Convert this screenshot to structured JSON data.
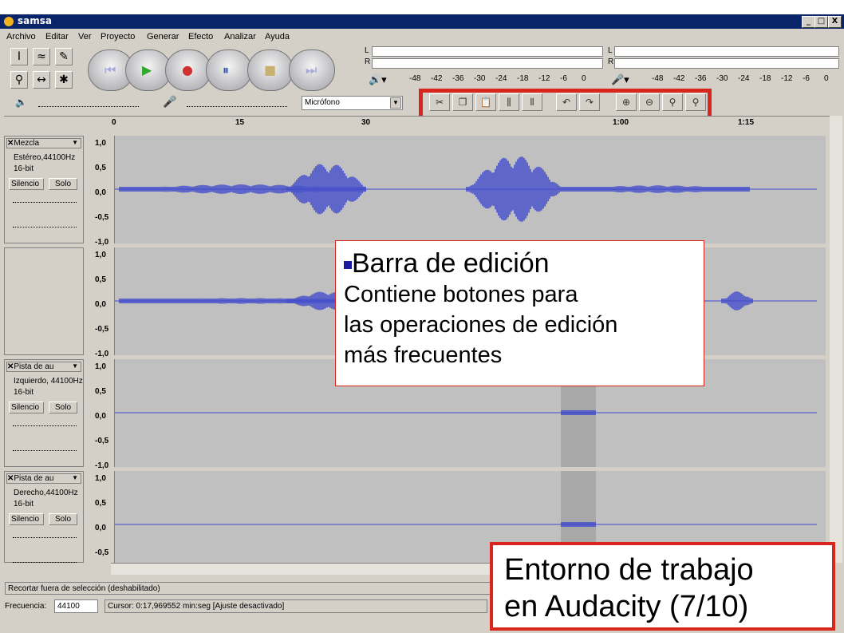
{
  "window": {
    "title": "samsa",
    "buttons": [
      "_",
      "□",
      "X"
    ]
  },
  "menu": [
    "Archivo",
    "Editar",
    "Ver",
    "Proyecto",
    "Generar",
    "Efecto",
    "Analizar",
    "Ayuda"
  ],
  "meters": {
    "left_label": "L",
    "right_label": "R",
    "scale": [
      "-48",
      "-42",
      "-36",
      "-30",
      "-24",
      "-18",
      "-12",
      "-6",
      "0"
    ]
  },
  "mixer": {
    "input_select": "Micrófono"
  },
  "ruler": {
    "ticks": [
      "0",
      "15",
      "30",
      "1:00",
      "1:15"
    ]
  },
  "tracks": [
    {
      "name": "Mezcla",
      "info1": "Estéreo,44100Hz",
      "info2": "16-bit",
      "silence": "Silencio",
      "solo": "Solo",
      "scale": [
        "1,0",
        "0,5",
        "0,0",
        "-0,5",
        "-1,0"
      ]
    },
    {
      "scale": [
        "1,0",
        "0,5",
        "0,0",
        "-0,5",
        "-1,0"
      ]
    },
    {
      "name": "Pista de au",
      "info1": "Izquierdo, 44100Hz",
      "info2": "16-bit",
      "silence": "Silencio",
      "solo": "Solo",
      "scale": [
        "1,0",
        "0,5",
        "0,0",
        "-0,5",
        "-1,0"
      ]
    },
    {
      "name": "Pista de au",
      "info1": "Derecho,44100Hz",
      "info2": "16-bit",
      "silence": "Silencio",
      "solo": "Solo",
      "scale": [
        "1,0",
        "0,5",
        "0,0",
        "-0,5"
      ]
    }
  ],
  "slider_labels": {
    "minus": "-",
    "plus": "+",
    "l": "L",
    "r": "R"
  },
  "status": {
    "message": "Recortar fuera de selección (deshabilitado)",
    "rate_label": "Frecuencia:",
    "rate_value": "44100",
    "cursor": "Cursor: 0:17,969552 min:seg   [Ajuste desactivado]"
  },
  "callout_edit": {
    "title": "Barra de edición",
    "body1": "Contiene botones para",
    "body2": "las operaciones de edición",
    "body3": "más frecuentes"
  },
  "callout_title": {
    "line1": "Entorno de trabajo",
    "line2": "en  Audacity (7/10)"
  },
  "colors": {
    "accent_red": "#d9261c",
    "wave": "#3f48cc",
    "titlebar": "#0a246a"
  }
}
